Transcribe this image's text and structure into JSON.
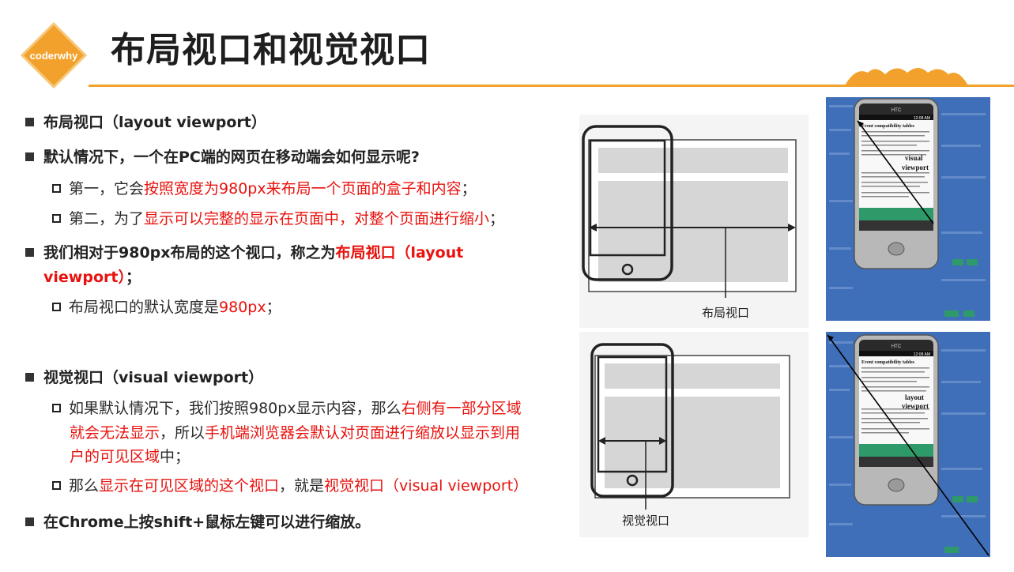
{
  "logo": {
    "text": "coderwhy",
    "color": "#f2a22c"
  },
  "title": "布局视口和视觉视口",
  "accent_color": "#f2a22c",
  "highlight_color": "#e8120e",
  "bullets": {
    "b1": "布局视口（layout viewport）",
    "b2": "默认情况下，一个在PC端的网页在移动端会如何显示呢?",
    "b2_s1_pre": "第一，它会",
    "b2_s1_red": "按照宽度为980px来布局一个页面的盒子和内容",
    "b2_s1_post": "；",
    "b2_s2_pre": "第二，为了",
    "b2_s2_red": "显示可以完整的显示在页面中，对整个页面进行缩小",
    "b2_s2_post": "；",
    "b3_pre": "我们相对于980px布局的这个视口，称之为",
    "b3_red_line1": "布局视口（layout",
    "b3_red_line2": "viewport）",
    "b3_post": "；",
    "b3_s1_pre": "布局视口的默认宽度是",
    "b3_s1_red": "980px",
    "b3_s1_post": "；",
    "b4": "视觉视口（visual viewport）",
    "b4_s1_pre": "如果默认情况下，我们按照980px显示内容，那么",
    "b4_s1_red1": "右侧有一部分区域",
    "b4_s1_red2": "就会无法显示",
    "b4_s1_mid": "，所以",
    "b4_s1_red3": "手机端浏览器会默认对页面进行缩放以显示到用",
    "b4_s1_red4": "户的可见区域",
    "b4_s1_post": "中；",
    "b4_s2_pre": "那么",
    "b4_s2_red1": "显示在可见区域的这个视口",
    "b4_s2_mid": "，就是",
    "b4_s2_red2": "视觉视口（visual viewport）",
    "b5": "在Chrome上按shift+鼠标左键可以进行缩放。"
  },
  "figures": {
    "layout_caption": "布局视口",
    "visual_caption": "视觉视口",
    "photo_top": {
      "brand": "HTC",
      "time": "12:08 AM",
      "heading": "Event compatibility tables",
      "overlay": "visual\nviewport"
    },
    "photo_bottom": {
      "brand": "HTC",
      "time": "12:08 AM",
      "heading": "Event compatibility tables",
      "overlay": "layout\nviewport"
    }
  }
}
